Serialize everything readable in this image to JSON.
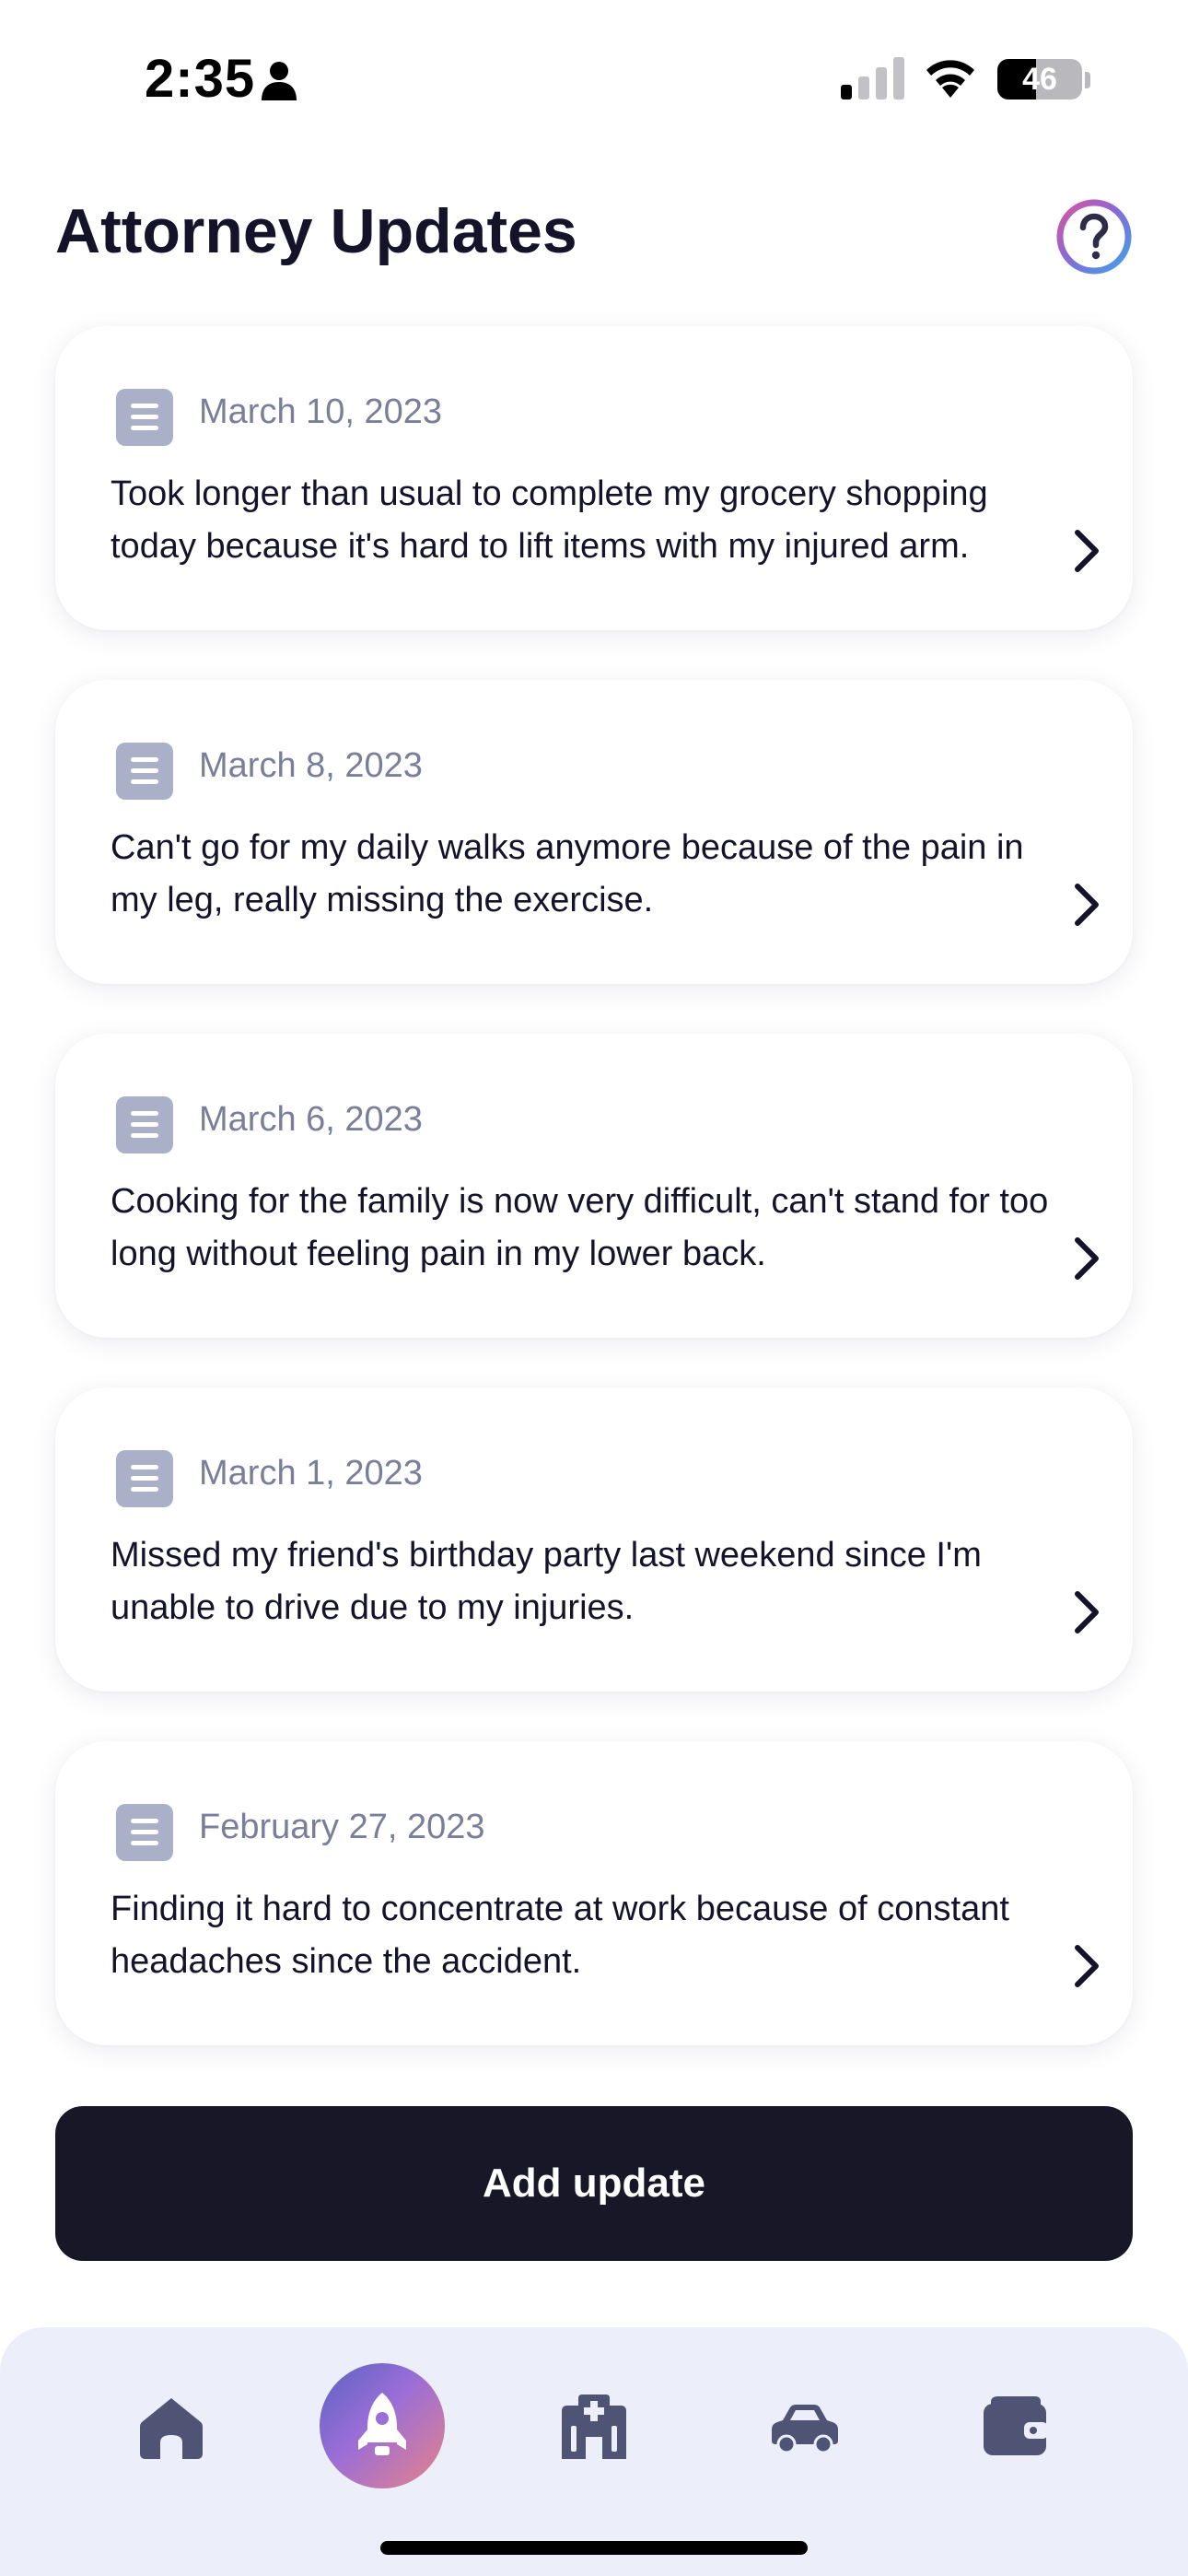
{
  "status_bar": {
    "time": "2:35",
    "battery": "46",
    "battery_level": 0.46
  },
  "header": {
    "title": "Attorney Updates",
    "help_icon": "question-circle-icon"
  },
  "updates": [
    {
      "date": "March 10, 2023",
      "text": "Took longer than usual to complete my grocery shopping today because it's hard to lift items with my injured arm."
    },
    {
      "date": "March 8, 2023",
      "text": "Can't go for my daily walks anymore because of the pain in my leg, really missing the exercise."
    },
    {
      "date": "March 6, 2023",
      "text": "Cooking for the family is now very difficult, can't stand for too long without feeling pain in my lower back."
    },
    {
      "date": "March 1, 2023",
      "text": "Missed my friend's birthday party last weekend since I'm unable to drive due to my injuries."
    },
    {
      "date": "February 27, 2023",
      "text": "Finding it hard to concentrate at work because of constant headaches since the accident."
    }
  ],
  "actions": {
    "add_update_label": "Add update"
  },
  "bottom_nav": {
    "items": [
      "home-icon",
      "rocket-icon",
      "hospital-icon",
      "car-icon",
      "wallet-icon"
    ],
    "active": "rocket-icon"
  },
  "colors": {
    "primary_dark": "#181728",
    "nav_background": "#eceffa",
    "nav_icon": "#4f5475",
    "doc_icon": "#aab0c8",
    "date_text": "#7a7f99"
  }
}
